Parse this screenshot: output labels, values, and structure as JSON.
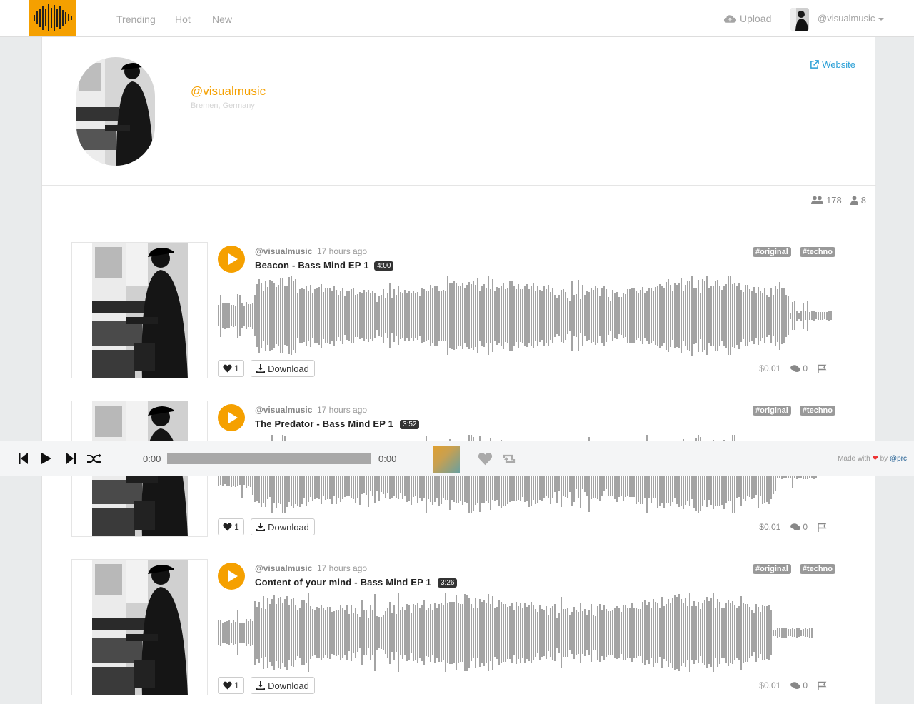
{
  "nav": {
    "links": [
      "Trending",
      "Hot",
      "New"
    ],
    "upload_label": "Upload",
    "username": "@visualmusic"
  },
  "profile": {
    "name": "@visualmusic",
    "location": "Bremen, Germany",
    "website_label": "Website",
    "followers": "178",
    "following": "8"
  },
  "tracks": [
    {
      "user": "@visualmusic",
      "time": "17 hours ago",
      "title": "Beacon - Bass Mind EP 1",
      "duration": "4:00",
      "tags": [
        "#original",
        "#techno"
      ],
      "likes": "1",
      "download_label": "Download",
      "price": "$0.01",
      "comments": "0"
    },
    {
      "user": "@visualmusic",
      "time": "17 hours ago",
      "title": "The Predator - Bass Mind EP 1",
      "duration": "3:52",
      "tags": [
        "#original",
        "#techno"
      ],
      "likes": "1",
      "download_label": "Download",
      "price": "$0.01",
      "comments": "0"
    },
    {
      "user": "@visualmusic",
      "time": "17 hours ago",
      "title": "Content of your mind - Bass Mind EP 1",
      "duration": "3:26",
      "tags": [
        "#original",
        "#techno"
      ],
      "likes": "1",
      "download_label": "Download",
      "price": "$0.01",
      "comments": "0"
    }
  ],
  "player": {
    "current_time": "0:00",
    "total_time": "0:00",
    "made_with": "Made with",
    "by_text": "by",
    "author": "@prc"
  },
  "colors": {
    "accent": "#f5a000",
    "link": "#2a9fd6",
    "waveform": "#a4a4a4"
  }
}
